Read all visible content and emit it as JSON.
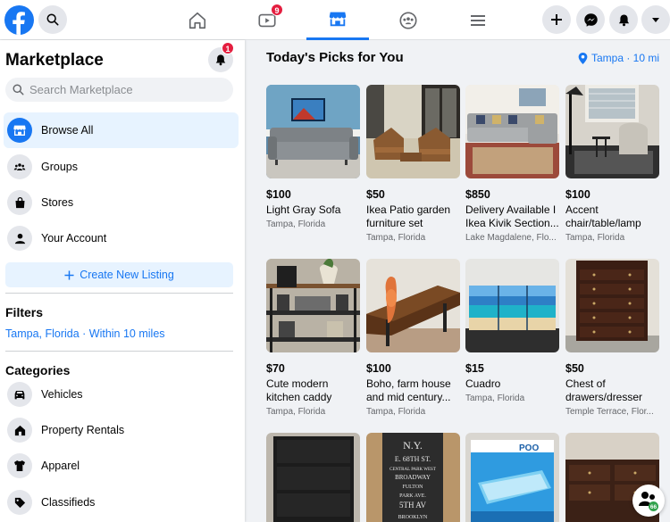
{
  "header": {
    "active_tab": "marketplace",
    "watch_badge": "9",
    "accent": "#1877f2"
  },
  "sidebar": {
    "title": "Marketplace",
    "notification_badge": "1",
    "search_placeholder": "Search Marketplace",
    "nav": [
      {
        "label": "Browse All",
        "icon": "storefront-icon"
      },
      {
        "label": "Groups",
        "icon": "groups-icon"
      },
      {
        "label": "Stores",
        "icon": "bag-icon"
      },
      {
        "label": "Your Account",
        "icon": "person-icon"
      }
    ],
    "create_label": "Create New Listing",
    "filters_title": "Filters",
    "filter_value": "Tampa, Florida · Within 10 miles",
    "categories_title": "Categories",
    "categories": [
      {
        "label": "Vehicles",
        "icon": "car-icon"
      },
      {
        "label": "Property Rentals",
        "icon": "house-icon"
      },
      {
        "label": "Apparel",
        "icon": "shirt-icon"
      },
      {
        "label": "Classifieds",
        "icon": "tag-icon"
      }
    ]
  },
  "main": {
    "title": "Today's Picks for You",
    "location": "Tampa · 10 mi",
    "listings": [
      {
        "price": "$100",
        "title": "Light Gray Sofa",
        "location": "Tampa, Florida"
      },
      {
        "price": "$50",
        "title": "Ikea Patio garden furniture set",
        "location": "Tampa, Florida"
      },
      {
        "price": "$850",
        "title": "Delivery Available I Ikea Kivik Section...",
        "location": "Lake Magdalene, Flo..."
      },
      {
        "price": "$100",
        "title": "Accent chair/table/lamp",
        "location": "Tampa, Florida"
      },
      {
        "price": "$70",
        "title": "Cute modern kitchen caddy",
        "location": "Tampa, Florida"
      },
      {
        "price": "$100",
        "title": "Boho, farm house and mid century...",
        "location": "Tampa, Florida"
      },
      {
        "price": "$15",
        "title": "Cuadro",
        "location": "Tampa, Florida"
      },
      {
        "price": "$50",
        "title": "Chest of drawers/dresser",
        "location": "Temple Terrace, Flor..."
      }
    ],
    "photo_sign_text": [
      "N.Y.",
      "E. 68TH ST.",
      "CENTRAL PARK WEST",
      "BROADWAY",
      "FULTON",
      "PARK AVE.",
      "5TH AV",
      "BROOKLYN"
    ],
    "photo_box_text": "POO",
    "contacts_count": "66"
  }
}
